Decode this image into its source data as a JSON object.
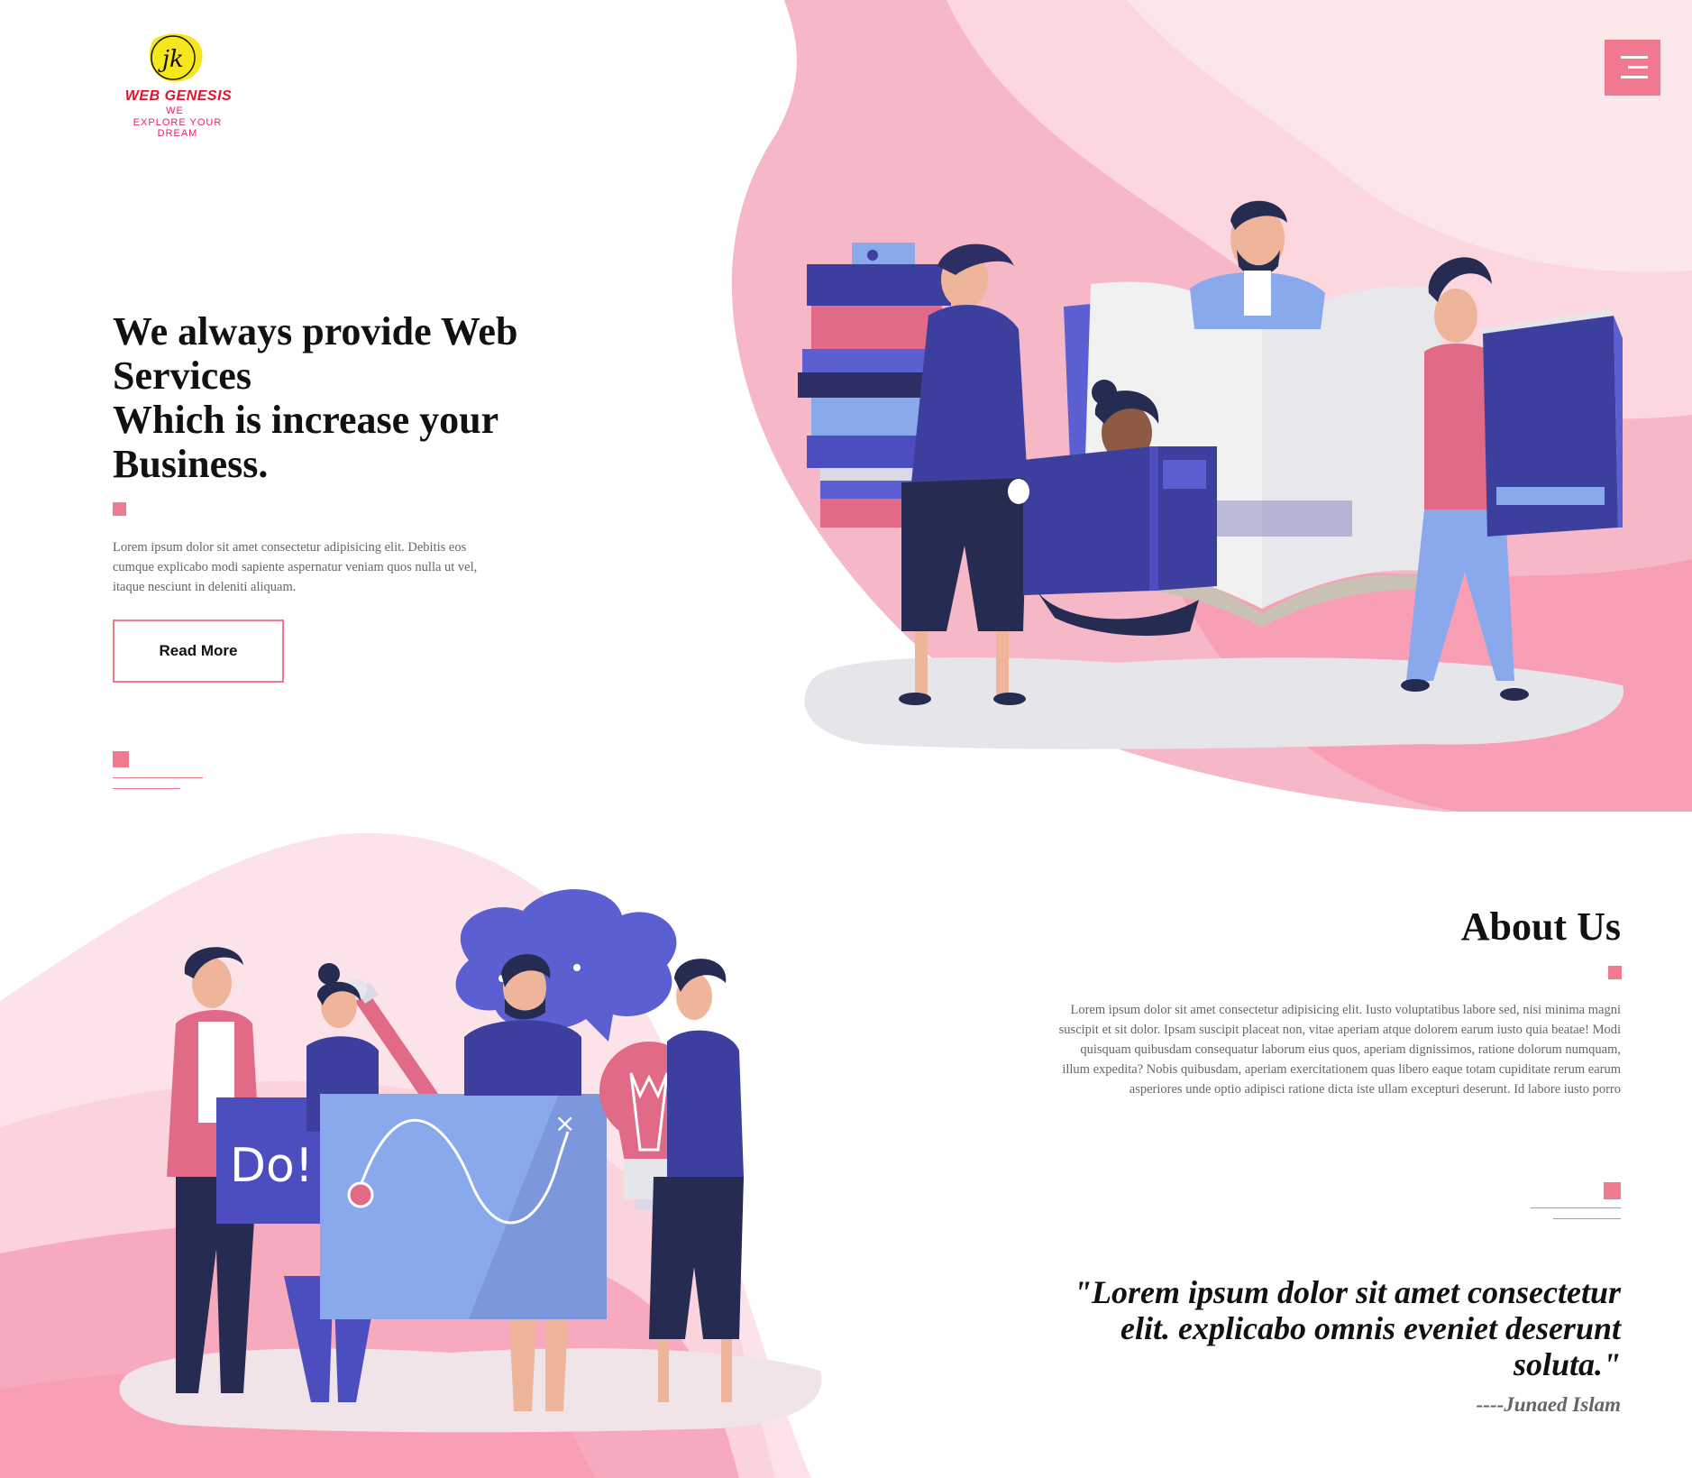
{
  "logo": {
    "monogram": "jk",
    "brand": "WEB GENESIS",
    "we": "WE",
    "tagline": "EXPLORE YOUR DREAM"
  },
  "header": {
    "menu_icon": "hamburger-menu-icon"
  },
  "hero": {
    "title_lines": [
      "We always provide Web",
      "Services",
      "Which is increase your",
      "Business."
    ],
    "text": "Lorem ipsum dolor sit amet consectetur adipisicing elit. Debitis eos cumque explicabo modi sapiente aspernatur veniam quos nulla ut vel, itaque nesciunt in deleniti aliquam.",
    "button_label": "Read More",
    "illustration": "people-with-books-illustration"
  },
  "about": {
    "title": "About Us",
    "text": "Lorem ipsum dolor sit amet consectetur adipisicing elit. Iusto voluptatibus labore sed, nisi minima magni suscipit et sit dolor. Ipsam suscipit placeat non, vitae aperiam atque dolorem earum iusto quia beatae! Modi quisquam quibusdam consequatur laborum eius quos, aperiam dignissimos, ratione dolorum numquam, illum expedita? Nobis quibusdam, aperiam exercitationem quas libero eaque totam cupiditate rerum earum asperiores unde optio adipisci ratione dicta iste ullam excepturi deserunt. Id labore iusto porro",
    "quote": "\"Lorem ipsum dolor sit amet consectetur elit. explicabo omnis eveniet deserunt soluta.\"",
    "quote_author": "----Junaed Islam",
    "illustration": "team-brainstorming-illustration",
    "board_text": "Do!"
  },
  "colors": {
    "accent": "#f0788f",
    "pink_light": "#fbd9e1",
    "pink_mid": "#f7a9bd",
    "indigo": "#3d3f9e",
    "periwinkle": "#8aa8ec"
  }
}
